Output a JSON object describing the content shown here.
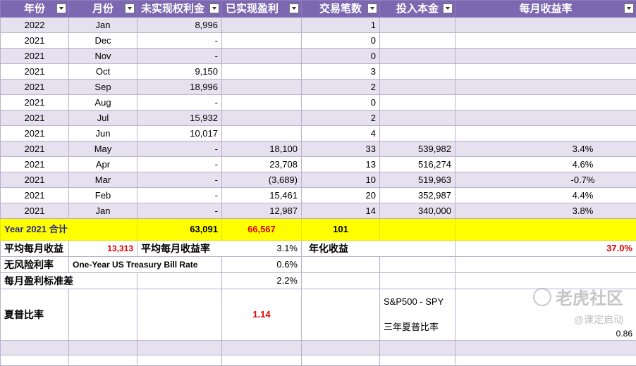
{
  "headers": [
    "年份",
    "月份",
    "未实现权利金",
    "已实现盈利",
    "交易笔数",
    "投入本金",
    "每月收益率"
  ],
  "rows": [
    {
      "year": "2022",
      "month": "Jan",
      "unrealized": "8,996",
      "realized": "",
      "trades": "1",
      "capital": "",
      "rate": ""
    },
    {
      "year": "2021",
      "month": "Dec",
      "unrealized": "-",
      "realized": "",
      "trades": "0",
      "capital": "",
      "rate": ""
    },
    {
      "year": "2021",
      "month": "Nov",
      "unrealized": "-",
      "realized": "",
      "trades": "0",
      "capital": "",
      "rate": ""
    },
    {
      "year": "2021",
      "month": "Oct",
      "unrealized": "9,150",
      "realized": "",
      "trades": "3",
      "capital": "",
      "rate": ""
    },
    {
      "year": "2021",
      "month": "Sep",
      "unrealized": "18,996",
      "realized": "",
      "trades": "2",
      "capital": "",
      "rate": ""
    },
    {
      "year": "2021",
      "month": "Aug",
      "unrealized": "-",
      "realized": "",
      "trades": "0",
      "capital": "",
      "rate": ""
    },
    {
      "year": "2021",
      "month": "Jul",
      "unrealized": "15,932",
      "realized": "",
      "trades": "2",
      "capital": "",
      "rate": ""
    },
    {
      "year": "2021",
      "month": "Jun",
      "unrealized": "10,017",
      "realized": "",
      "trades": "4",
      "capital": "",
      "rate": ""
    },
    {
      "year": "2021",
      "month": "May",
      "unrealized": "-",
      "realized": "18,100",
      "trades": "33",
      "capital": "539,982",
      "rate": "3.4%"
    },
    {
      "year": "2021",
      "month": "Apr",
      "unrealized": "-",
      "realized": "23,708",
      "trades": "13",
      "capital": "516,274",
      "rate": "4.6%"
    },
    {
      "year": "2021",
      "month": "Mar",
      "unrealized": "-",
      "realized": "(3,689)",
      "trades": "10",
      "capital": "519,963",
      "rate": "-0.7%"
    },
    {
      "year": "2021",
      "month": "Feb",
      "unrealized": "-",
      "realized": "15,461",
      "trades": "20",
      "capital": "352,987",
      "rate": "4.4%"
    },
    {
      "year": "2021",
      "month": "Jan",
      "unrealized": "-",
      "realized": "12,987",
      "trades": "14",
      "capital": "340,000",
      "rate": "3.8%"
    }
  ],
  "total": {
    "label": "Year 2021 合计",
    "unrealized": "63,091",
    "realized": "66,567",
    "trades": "101"
  },
  "summary": {
    "avg_monthly_profit_label": "平均每月收益",
    "avg_monthly_profit": "13,313",
    "avg_monthly_rate_label": "平均每月收益率",
    "avg_monthly_rate": "3.1%",
    "annual_label": "年化收益",
    "annual": "37.0%",
    "riskfree_label": "无风险利率",
    "riskfree_desc": "One-Year US Treasury Bill Rate",
    "riskfree": "0.6%",
    "stdev_label": "每月盈利标准差",
    "stdev": "2.2%",
    "sharpe_label": "夏普比率",
    "sharpe": "1.14",
    "spy_label1": "S&P500 - SPY",
    "spy_label2": "三年夏普比率",
    "spy_sharpe": "0.86"
  },
  "watermark": {
    "brand": "老虎社区",
    "sub": "@课定启动"
  },
  "colors": {
    "header": "#7b68b0",
    "band": "#e6e1ef",
    "total": "#ffff00",
    "accent_red": "#e00000"
  }
}
